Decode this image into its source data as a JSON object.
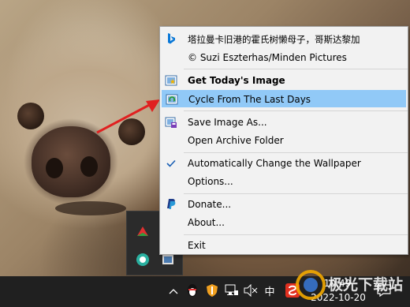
{
  "menu": {
    "title_cn": "塔拉曼卡旧港的霍氏树懒母子，哥斯达黎加",
    "copyright": "© Suzi Eszterhas/Minden Pictures",
    "items": [
      {
        "label": "Get Today's Image",
        "icon": "bing-image-star-icon"
      },
      {
        "label": "Cycle From The Last Days",
        "icon": "cycle-refresh-icon"
      },
      {
        "label": "Save Image As...",
        "icon": "save-image-icon"
      },
      {
        "label": "Open Archive Folder",
        "icon": ""
      },
      {
        "label": "Automatically Change the Wallpaper",
        "icon": "checkmark-icon",
        "checked": true
      },
      {
        "label": "Options...",
        "icon": ""
      },
      {
        "label": "Donate...",
        "icon": "paypal-icon"
      },
      {
        "label": "About...",
        "icon": ""
      },
      {
        "label": "Exit",
        "icon": ""
      }
    ]
  },
  "taskbar": {
    "time": "10:49",
    "date": "2022-10-20",
    "ime": "中",
    "tray_icons": [
      "chevron-up-icon",
      "qq-penguin-icon",
      "shield-icon",
      "network-icon",
      "speaker-mute-icon",
      "ime-icon",
      "antivirus-icon",
      "notification-icon"
    ]
  },
  "watermark": {
    "text": "极光下载站"
  },
  "colors": {
    "highlight": "#91c9f7",
    "menu_bg": "#f2f2f2",
    "taskbar_bg": "#202020",
    "arrow": "#e02020",
    "bing_blue": "#0a78d7"
  }
}
